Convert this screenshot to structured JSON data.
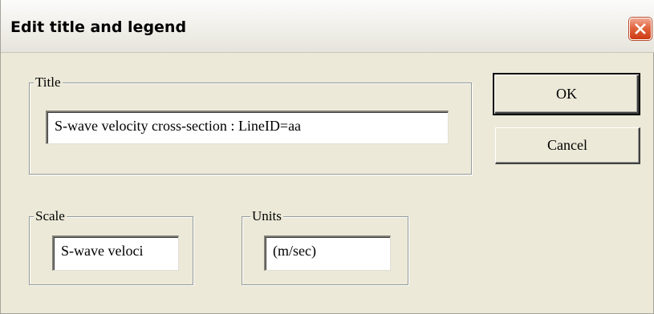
{
  "dialog": {
    "title": "Edit title and legend",
    "close_icon": "close-x-icon"
  },
  "title_group": {
    "label": "Title",
    "value": "S-wave velocity cross-section : LineID=aa"
  },
  "scale_group": {
    "label": "Scale",
    "value": "S-wave veloci"
  },
  "units_group": {
    "label": "Units",
    "value": "(m/sec)"
  },
  "buttons": {
    "ok_label": "OK",
    "cancel_label": "Cancel"
  },
  "colors": {
    "dialog_background": "#ece9d8",
    "close_button": "#d95b30"
  }
}
